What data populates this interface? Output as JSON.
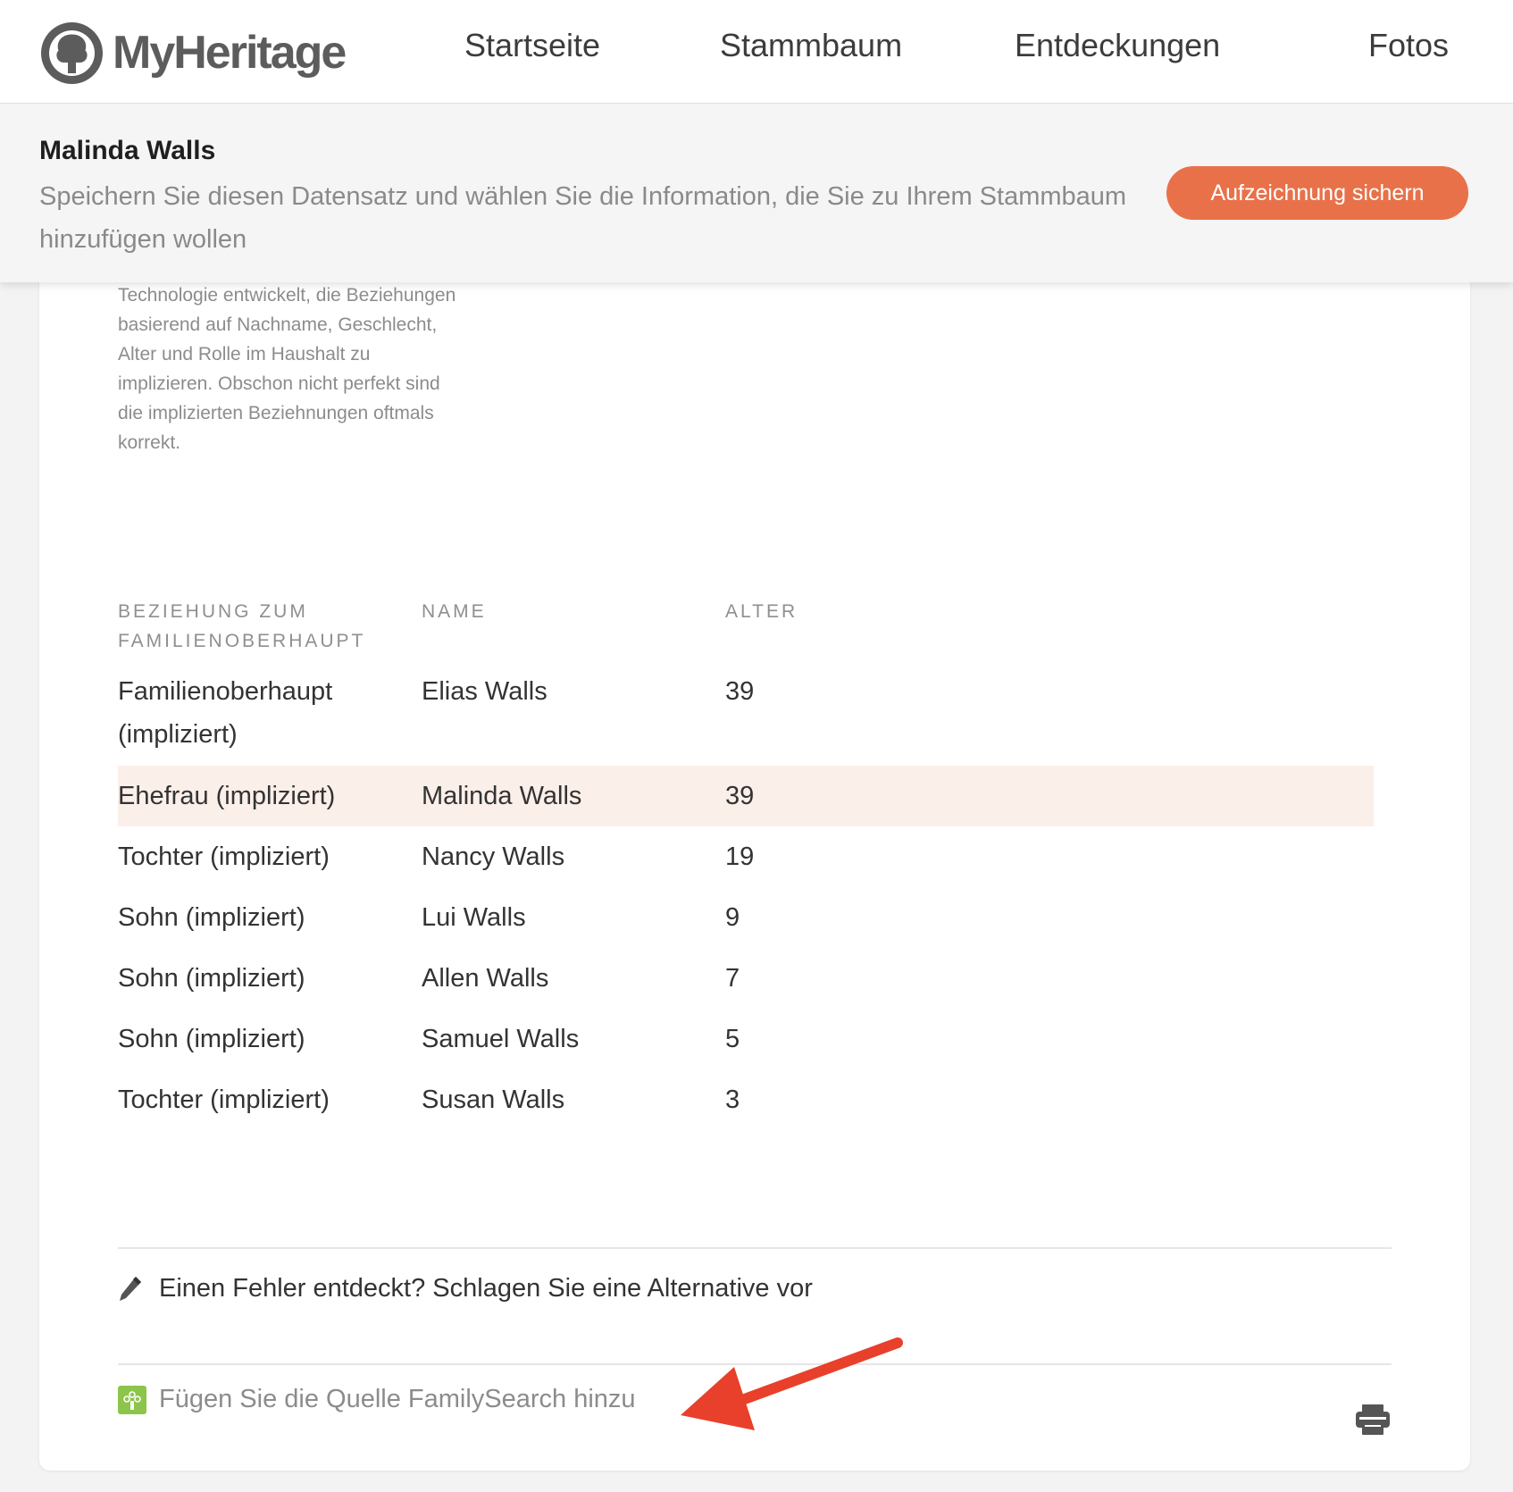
{
  "nav": {
    "logo_text": "MyHeritage",
    "items": [
      "Startseite",
      "Stammbaum",
      "Entdeckungen",
      "Fotos"
    ]
  },
  "banner": {
    "name": "Malinda Walls",
    "description": "Speichern Sie diesen Datensatz und wählen Sie die Information, die Sie zu Ihrem Stammbaum hinzufügen wollen",
    "save_label": "Aufzeichnung sichern"
  },
  "note": "Technologie entwickelt, die Beziehungen basierend auf Nachname, Geschlecht, Alter und Rolle im Haushalt zu implizieren. Obschon nicht perfekt sind die implizierten Beziehnungen oftmals korrekt.",
  "table": {
    "headers": {
      "relationship": "Beziehung zum Familienoberhaupt",
      "name": "Name",
      "age": "Alter"
    },
    "rows": [
      {
        "relationship": "Familienoberhaupt (impliziert)",
        "name": "Elias Walls",
        "age": "39"
      },
      {
        "relationship": "Ehefrau (impliziert)",
        "name": "Malinda Walls",
        "age": "39"
      },
      {
        "relationship": "Tochter (impliziert)",
        "name": "Nancy Walls",
        "age": "19"
      },
      {
        "relationship": "Sohn (impliziert)",
        "name": "Lui Walls",
        "age": "9"
      },
      {
        "relationship": "Sohn (impliziert)",
        "name": "Allen Walls",
        "age": "7"
      },
      {
        "relationship": "Sohn (impliziert)",
        "name": "Samuel Walls",
        "age": "5"
      },
      {
        "relationship": "Tochter (impliziert)",
        "name": "Susan Walls",
        "age": "3"
      }
    ],
    "highlighted_row": 1
  },
  "suggest_text": "Einen Fehler entdeckt? Schlagen Sie eine Alternative vor",
  "source_text": "Fügen Sie die Quelle FamilySearch hinzu",
  "colors": {
    "accent": "#e8714a",
    "highlight_row": "#fbefea",
    "familysearch_green": "#8cc54a",
    "annotation_arrow": "#e8402a"
  },
  "icons": [
    "myheritage-logo-icon",
    "pencil-icon",
    "familysearch-icon",
    "print-icon",
    "annotation-arrow"
  ]
}
